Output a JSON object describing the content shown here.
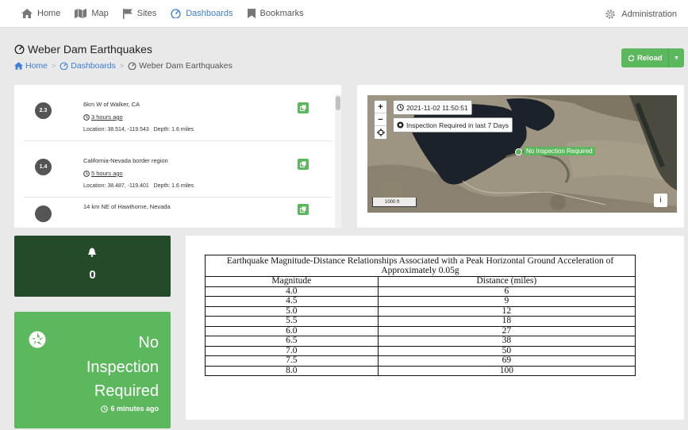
{
  "nav": {
    "home": "Home",
    "map": "Map",
    "sites": "Sites",
    "dashboards": "Dashboards",
    "bookmarks": "Bookmarks",
    "administration": "Administration"
  },
  "page": {
    "title": "Weber Dam Earthquakes",
    "breadcrumb": [
      "Home",
      "Dashboards",
      "Weber Dam Earthquakes"
    ]
  },
  "reload": {
    "label": "Reload"
  },
  "earthquakes": [
    {
      "magnitude": "2.3",
      "title": "6km W of Walker, CA",
      "time": "3 hours ago",
      "location": "Location: 38.514, -119.543   Depth: 1.6 miles"
    },
    {
      "magnitude": "1.4",
      "title": "California-Nevada border region",
      "time": "5 hours ago",
      "location": "Location: 38.487, -119.401   Depth: 1.6 miles"
    },
    {
      "magnitude": "",
      "title": "14 km NE of Hawthorne, Nevada",
      "time": "",
      "location": ""
    }
  ],
  "map": {
    "timestamp": "2021-11-02 11:50:51",
    "inspection_tag": "Inspection Required in last 7 Days",
    "marker_label": "No Inspection Required",
    "scale": "1000 ft",
    "info": "i"
  },
  "alerts": {
    "count": "0"
  },
  "status": {
    "lines": [
      "No",
      "Inspection",
      "Required"
    ],
    "ago": "6 minutes ago"
  },
  "table": {
    "caption": "Earthquake Magnitude-Distance Relationships Associated with a Peak Horizontal Ground Acceleration of Approximately 0.05g",
    "headers": [
      "Magnitude",
      "Distance (miles)"
    ],
    "rows": [
      [
        "4.0",
        "6"
      ],
      [
        "4.5",
        "9"
      ],
      [
        "5.0",
        "12"
      ],
      [
        "5.5",
        "18"
      ],
      [
        "6.0",
        "27"
      ],
      [
        "6.5",
        "38"
      ],
      [
        "7.0",
        "50"
      ],
      [
        "7.5",
        "69"
      ],
      [
        "8.0",
        "100"
      ]
    ]
  },
  "colors": {
    "accent": "#3b7dd8",
    "success": "#5cb85c",
    "dark_green": "#234a29",
    "background": "#e9e9e9"
  }
}
